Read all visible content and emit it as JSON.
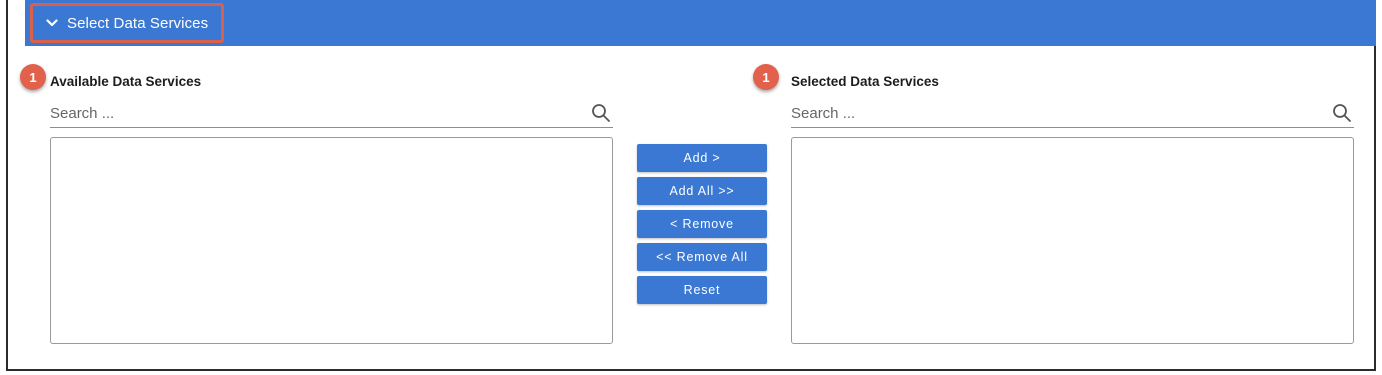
{
  "header": {
    "title": "Select Data Services",
    "toggle_icon": "chevron-down-icon",
    "bar_color": "#3a78d4",
    "highlight_color": "#d9604b"
  },
  "available": {
    "badge": "1",
    "title": "Available Data Services",
    "search_placeholder": "Search ...",
    "items": []
  },
  "selected": {
    "badge": "1",
    "title": "Selected Data Services",
    "search_placeholder": "Search ...",
    "items": []
  },
  "actions": {
    "add": "Add >",
    "add_all": "Add All >>",
    "remove": "< Remove",
    "remove_all": "<< Remove All",
    "reset": "Reset"
  },
  "colors": {
    "accent": "#3a78d4",
    "badge": "#e2614c"
  }
}
